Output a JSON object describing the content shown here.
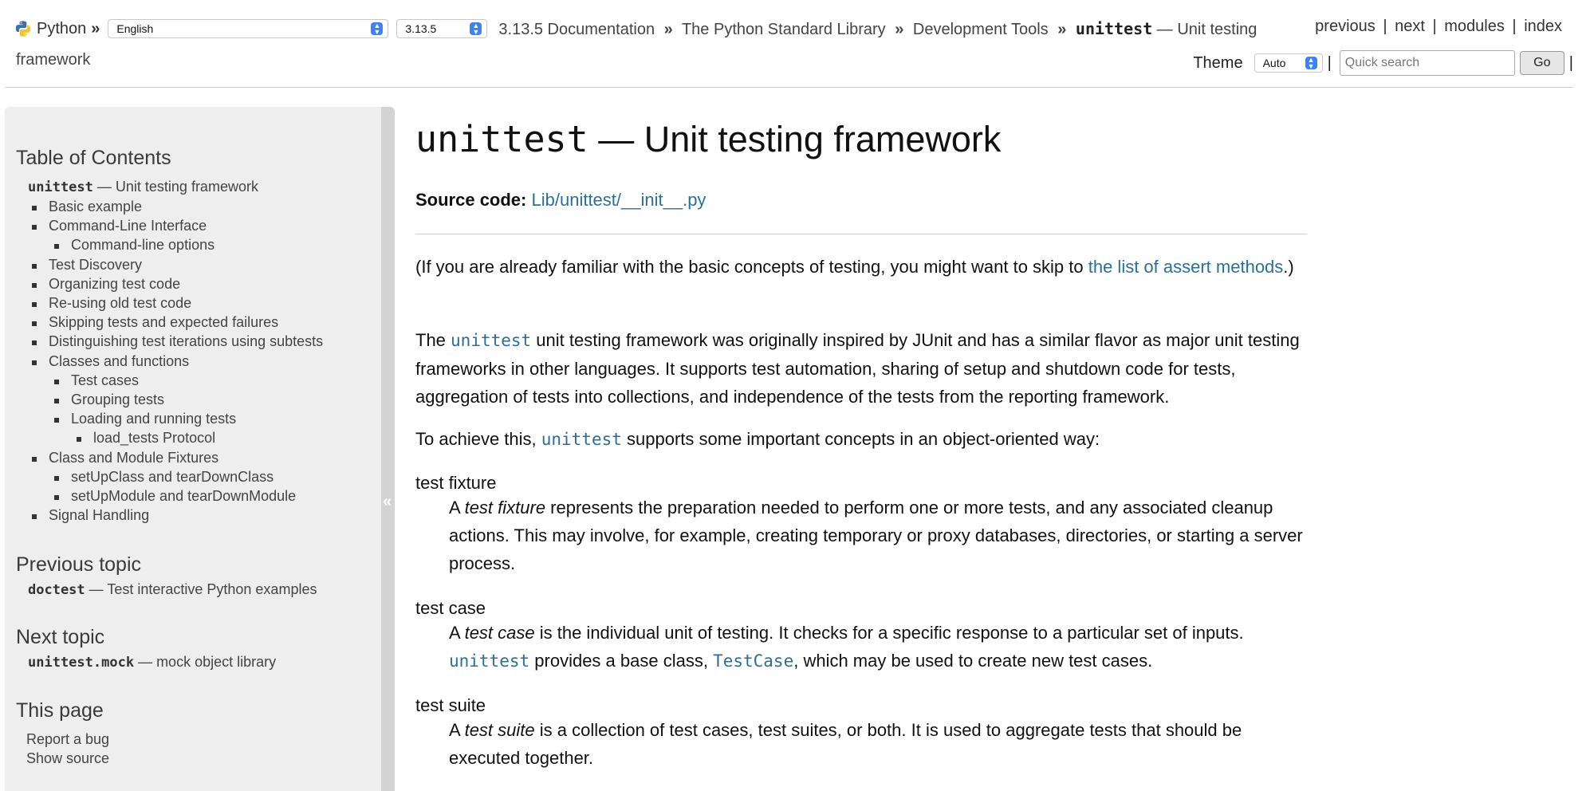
{
  "header": {
    "home_label": "Python",
    "crumb_sep": "»",
    "language_value": "English",
    "version_value": "3.13.5",
    "breadcrumbs": [
      "3.13.5 Documentation",
      "The Python Standard Library",
      "Development Tools"
    ],
    "current_mono": "unittest",
    "current_rest": " — Unit testing",
    "current_cont": "framework",
    "relnav": [
      "previous",
      "next",
      "modules",
      "index"
    ],
    "pipe": "|",
    "theme_label": "Theme",
    "theme_value": "Auto",
    "search_placeholder": "Quick search",
    "go_label": "Go"
  },
  "sidebar": {
    "toc_heading": "Table of Contents",
    "toc_root_mono": "unittest",
    "toc_root_rest": " — Unit testing framework",
    "toc_items": [
      {
        "label": "Basic example",
        "level": 1
      },
      {
        "label": "Command-Line Interface",
        "level": 1
      },
      {
        "label": "Command-line options",
        "level": 2
      },
      {
        "label": "Test Discovery",
        "level": 1
      },
      {
        "label": "Organizing test code",
        "level": 1
      },
      {
        "label": "Re-using old test code",
        "level": 1
      },
      {
        "label": "Skipping tests and expected failures",
        "level": 1
      },
      {
        "label": "Distinguishing test iterations using subtests",
        "level": 1
      },
      {
        "label": "Classes and functions",
        "level": 1
      },
      {
        "label": "Test cases",
        "level": 2
      },
      {
        "label": "Grouping tests",
        "level": 2
      },
      {
        "label": "Loading and running tests",
        "level": 2
      },
      {
        "label": "load_tests Protocol",
        "level": 3
      },
      {
        "label": "Class and Module Fixtures",
        "level": 1
      },
      {
        "label": "setUpClass and tearDownClass",
        "level": 2
      },
      {
        "label": "setUpModule and tearDownModule",
        "level": 2
      },
      {
        "label": "Signal Handling",
        "level": 1
      }
    ],
    "prev_heading": "Previous topic",
    "prev_mono": "doctest",
    "prev_rest": " — Test interactive Python examples",
    "next_heading": "Next topic",
    "next_mono": "unittest.mock",
    "next_rest": " — mock object library",
    "this_page_heading": "This page",
    "report_bug": "Report a bug",
    "show_source": "Show source",
    "collapse_glyph": "«"
  },
  "main": {
    "title_mono": "unittest",
    "title_rest": " — Unit testing framework",
    "source_label": "Source code:",
    "source_link": "Lib/unittest/__init__.py",
    "p1_a": "(If you are already familiar with the basic concepts of testing, you might want to skip to ",
    "p1_link": "the list of assert methods",
    "p1_b": ".)",
    "p2_a": "The ",
    "p2_code": "unittest",
    "p2_b": " unit testing framework was originally inspired by JUnit and has a similar flavor as major unit testing frameworks in other languages. It supports test automation, sharing of setup and shutdown code for tests, aggregation of tests into collections, and independence of the tests from the reporting framework.",
    "p3_a": "To achieve this, ",
    "p3_code": "unittest",
    "p3_b": " supports some important concepts in an object-oriented way:",
    "fixture_term": "test fixture",
    "fixture_a": "A ",
    "fixture_em": "test fixture",
    "fixture_b": " represents the preparation needed to perform one or more tests, and any associated cleanup actions. This may involve, for example, creating temporary or proxy databases, directories, or starting a server process.",
    "case_term": "test case",
    "case_a": "A ",
    "case_em": "test case",
    "case_b": " is the individual unit of testing. It checks for a specific response to a particular set of inputs. ",
    "case_code1": "unittest",
    "case_c": " provides a base class, ",
    "case_code2": "TestCase",
    "case_d": ", which may be used to create new test cases.",
    "suite_term": "test suite",
    "suite_a": "A ",
    "suite_em": "test suite",
    "suite_b": " is a collection of test cases, test suites, or both. It is used to aggregate tests that should be executed together."
  }
}
